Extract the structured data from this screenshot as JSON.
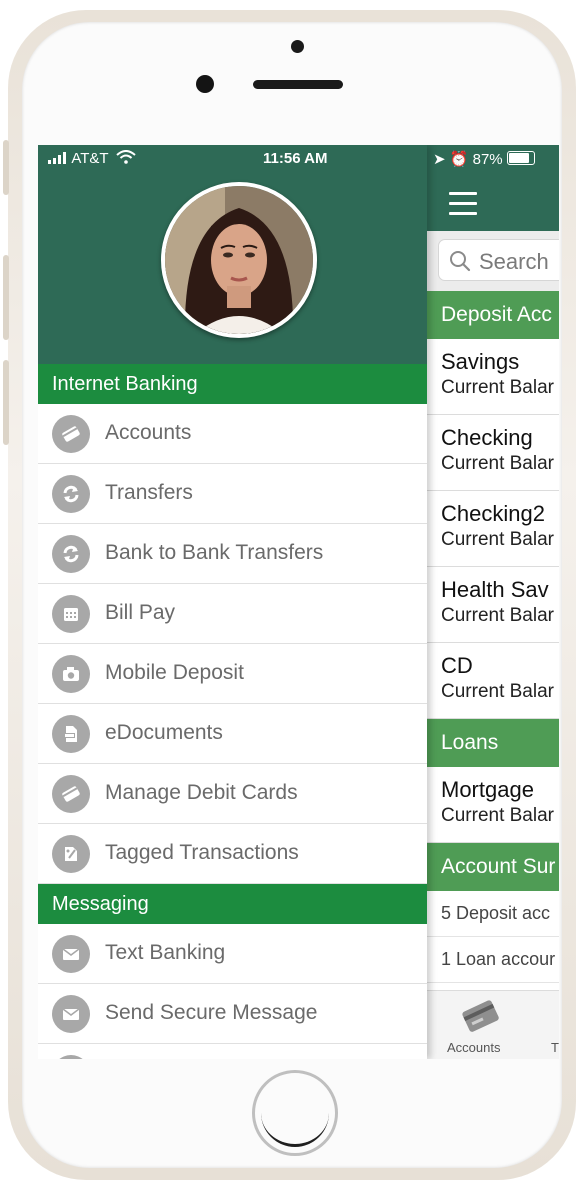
{
  "status": {
    "carrier": "AT&T",
    "time": "11:56 AM",
    "battery": "87%"
  },
  "menu": {
    "groups": [
      {
        "title": "Internet Banking",
        "items": [
          {
            "label": "Accounts",
            "icon": "card-icon"
          },
          {
            "label": "Transfers",
            "icon": "transfer-icon"
          },
          {
            "label": "Bank to Bank Transfers",
            "icon": "transfer-icon"
          },
          {
            "label": "Bill Pay",
            "icon": "calendar-icon"
          },
          {
            "label": "Mobile Deposit",
            "icon": "camera-icon"
          },
          {
            "label": "eDocuments",
            "icon": "document-icon"
          },
          {
            "label": "Manage Debit Cards",
            "icon": "card-icon"
          },
          {
            "label": "Tagged Transactions",
            "icon": "tag-icon"
          }
        ]
      },
      {
        "title": "Messaging",
        "items": [
          {
            "label": "Text Banking",
            "icon": "envelope-icon"
          },
          {
            "label": "Send Secure Message",
            "icon": "envelope-icon"
          }
        ]
      }
    ]
  },
  "app": {
    "search_placeholder": "Search",
    "deposit_header": "Deposit Acc",
    "accounts": [
      {
        "name": "Savings",
        "balance": "Current Balar"
      },
      {
        "name": "Checking",
        "balance": "Current Balar"
      },
      {
        "name": "Checking2",
        "balance": "Current Balar"
      },
      {
        "name": "Health Sav",
        "balance": "Current Balar"
      },
      {
        "name": "CD",
        "balance": "Current Balar"
      }
    ],
    "loans_header": "Loans",
    "loans": [
      {
        "name": "Mortgage",
        "balance": "Current Balar"
      }
    ],
    "summary_header": "Account Sur",
    "summary": [
      "5 Deposit acc",
      "1 Loan accour"
    ],
    "tabs": [
      "Accounts",
      "T"
    ]
  },
  "colors": {
    "header_green": "#2e6a56",
    "group_green": "#1c8c3f",
    "section_green": "#4f9c55"
  }
}
